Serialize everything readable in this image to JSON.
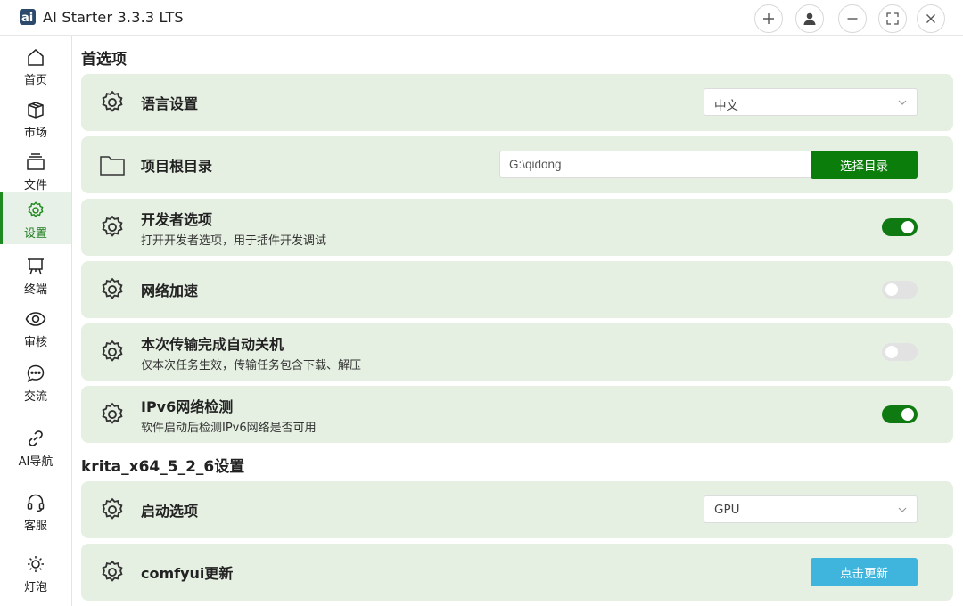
{
  "app": {
    "title": "AI Starter 3.3.3 LTS",
    "accent_color": "#0a7d0a",
    "card_bg": "#e5f0e2"
  },
  "titlebar": {
    "buttons": [
      "add-icon",
      "user-icon",
      "minimize-icon",
      "fullscreen-icon",
      "close-icon"
    ]
  },
  "sidebar": {
    "items": [
      {
        "label": "首页",
        "icon": "home-icon"
      },
      {
        "label": "市场",
        "icon": "package-icon"
      },
      {
        "label": "文件",
        "icon": "files-icon"
      },
      {
        "label": "设置",
        "icon": "gear-icon",
        "active": true
      },
      {
        "label": "终端",
        "icon": "terminal-icon"
      },
      {
        "label": "审核",
        "icon": "eye-icon"
      },
      {
        "label": "交流",
        "icon": "chat-icon"
      },
      {
        "label": "AI导航",
        "icon": "link-icon"
      },
      {
        "label": "客服",
        "icon": "headset-icon"
      },
      {
        "label": "灯泡",
        "icon": "sun-icon"
      }
    ]
  },
  "sections": {
    "general_title": "首选项",
    "app_title": "krita_x64_5_2_6设置"
  },
  "settings": {
    "language": {
      "title": "语言设置",
      "value": "中文"
    },
    "root_dir": {
      "title": "项目根目录",
      "path": "G:\\qidong",
      "button": "选择目录"
    },
    "developer": {
      "title": "开发者选项",
      "desc": "打开开发者选项，用于插件开发调试",
      "enabled": true
    },
    "network_boost": {
      "title": "网络加速",
      "enabled": false
    },
    "auto_shutdown": {
      "title": "本次传输完成自动关机",
      "desc": "仅本次任务生效，传输任务包含下载、解压",
      "enabled": false
    },
    "ipv6": {
      "title": "IPv6网络检测",
      "desc": "软件启动后检测IPv6网络是否可用",
      "enabled": true
    },
    "launch_option": {
      "title": "启动选项",
      "value": "GPU"
    },
    "comfyui_update": {
      "title": "comfyui更新",
      "button": "点击更新"
    }
  }
}
